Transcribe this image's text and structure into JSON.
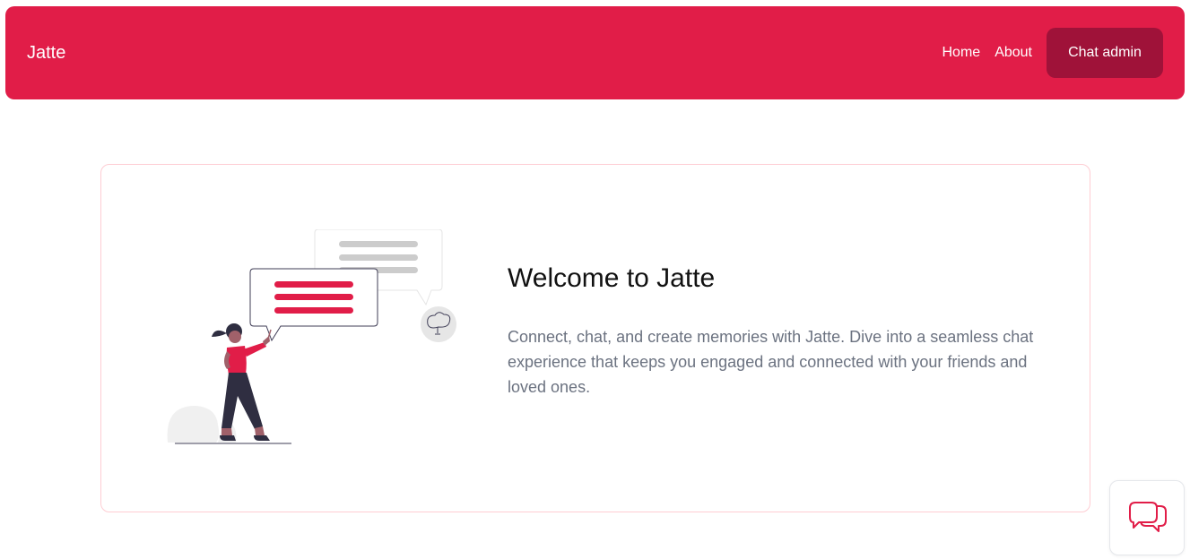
{
  "nav": {
    "brand": "Jatte",
    "links": [
      "Home",
      "About"
    ],
    "cta_label": "Chat admin"
  },
  "hero": {
    "title": "Welcome to Jatte",
    "description": "Connect, chat, and create memories with Jatte. Dive into a seamless chat experience that keeps you engaged and connected with your friends and loved ones."
  },
  "chat_widget": {
    "icon": "chat-bubbles-icon"
  },
  "colors": {
    "primary": "#e11d48",
    "primary_dark": "#9f1239",
    "card_border": "#fecdd3",
    "text_muted": "#6b7280"
  }
}
